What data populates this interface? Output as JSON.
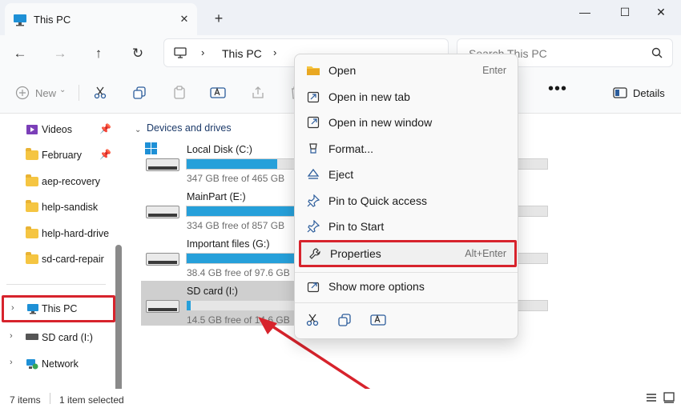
{
  "tab": {
    "title": "This PC",
    "close": "✕",
    "new": "+"
  },
  "window": {
    "minimize": "—",
    "maximize": "☐",
    "close": "✕"
  },
  "nav": {
    "back": "←",
    "forward": "→",
    "up": "↑",
    "refresh": "↻",
    "breadcrumb": "This PC",
    "search_placeholder": "Search This PC"
  },
  "toolbar": {
    "new_label": "New",
    "more": "•••",
    "details_label": "Details"
  },
  "sidebar": {
    "items": [
      {
        "label": "Videos",
        "pinned": true
      },
      {
        "label": "February",
        "pinned": true
      },
      {
        "label": "aep-recovery"
      },
      {
        "label": "help-sandisk"
      },
      {
        "label": "help-hard-drive"
      },
      {
        "label": "sd-card-repair"
      }
    ],
    "tree": [
      {
        "label": "This PC"
      },
      {
        "label": "SD card (I:)"
      },
      {
        "label": "Network"
      }
    ]
  },
  "content": {
    "section": "Devices and drives",
    "drives": [
      {
        "name": "Local Disk (C:)",
        "free": "347 GB free of 465 GB",
        "used_fraction": 0.25
      },
      {
        "name": "MainPart (E:)",
        "free": "334 GB free of 857 GB",
        "used_fraction": 0.61
      },
      {
        "name": "Important files (G:)",
        "free": "38.4 GB free of 97.6 GB",
        "used_fraction": 0.61
      },
      {
        "name": "SD card (I:)",
        "free": "14.5 GB free of 14.6 GB",
        "used_fraction": 0.01
      }
    ]
  },
  "context_menu": {
    "items": [
      {
        "label": "Open",
        "shortcut": "Enter",
        "icon": "folder-icon"
      },
      {
        "label": "Open in new tab",
        "shortcut": "",
        "icon": "new-tab-icon"
      },
      {
        "label": "Open in new window",
        "shortcut": "",
        "icon": "new-window-icon"
      },
      {
        "label": "Format...",
        "shortcut": "",
        "icon": "format-icon"
      },
      {
        "label": "Eject",
        "shortcut": "",
        "icon": "eject-icon"
      },
      {
        "label": "Pin to Quick access",
        "shortcut": "",
        "icon": "pin-icon"
      },
      {
        "label": "Pin to Start",
        "shortcut": "",
        "icon": "pin-icon"
      },
      {
        "label": "Properties",
        "shortcut": "Alt+Enter",
        "icon": "wrench-icon"
      },
      {
        "label": "Show more options",
        "shortcut": "",
        "icon": "more-options-icon"
      }
    ]
  },
  "status": {
    "items": "7 items",
    "selected": "1 item selected"
  },
  "colors": {
    "highlight": "#d7232c",
    "accent": "#26a0da",
    "selection": "#cfcfcf"
  }
}
